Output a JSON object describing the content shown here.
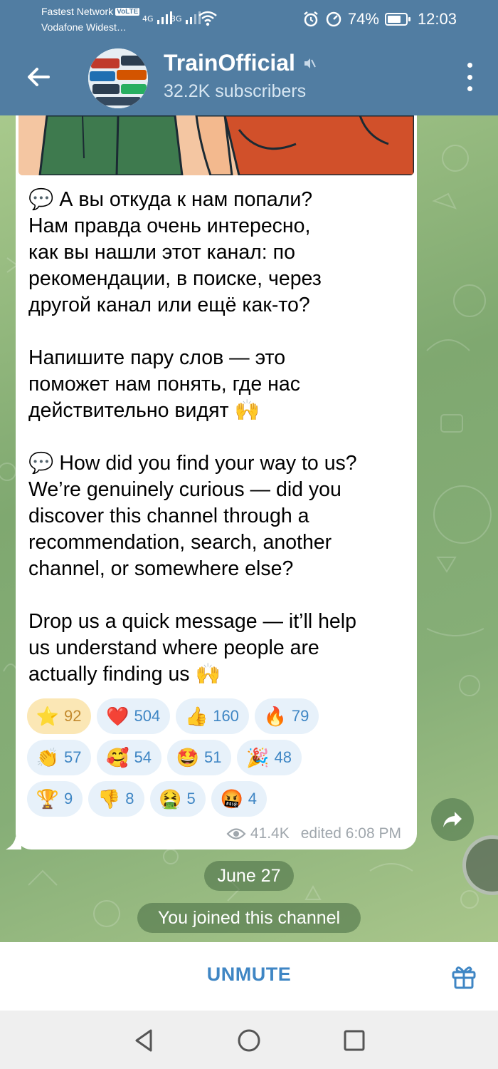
{
  "status_bar": {
    "carrier_line1": "Fastest Network",
    "volte": "VoLTE",
    "carrier_line2": "Vodafone Widest…",
    "net1": "4G",
    "net2": "3G",
    "battery_percent": "74%",
    "battery_level": 0.74,
    "time": "12:03"
  },
  "header": {
    "channel_name": "TrainOfficial",
    "subscribers": "32.2K subscribers",
    "muted": true
  },
  "message": {
    "para1": "А вы откуда к нам попали?\nНам правда очень интересно,\nкак вы нашли этот канал: по\nрекомендации, в поиске, через\nдругой канал или ещё как-то?",
    "para2": "Напишите пару слов — это\nпоможет нам понять, где нас\nдействительно видят",
    "para3": "How did you find your way to us?\nWe’re genuinely curious — did you\ndiscover this channel through a\nrecommendation, search, another\nchannel, or somewhere else?",
    "para4": "Drop us a quick message — it’ll help\nus understand where people are\nactually finding us",
    "views": "41.4K",
    "edited": "edited 6:08 PM"
  },
  "reactions": [
    [
      {
        "emoji": "⭐",
        "count": "92",
        "active": true
      },
      {
        "emoji": "❤️",
        "count": "504"
      },
      {
        "emoji": "👍",
        "count": "160"
      },
      {
        "emoji": "🔥",
        "count": "79"
      }
    ],
    [
      {
        "emoji": "👏",
        "count": "57"
      },
      {
        "emoji": "🥰",
        "count": "54"
      },
      {
        "emoji": "🤩",
        "count": "51"
      },
      {
        "emoji": "🎉",
        "count": "48"
      }
    ],
    [
      {
        "emoji": "🏆",
        "count": "9"
      },
      {
        "emoji": "👎",
        "count": "8"
      },
      {
        "emoji": "🤮",
        "count": "5"
      },
      {
        "emoji": "🤬",
        "count": "4"
      }
    ]
  ],
  "service": {
    "date": "June 27",
    "joined": "You joined this channel"
  },
  "bottom": {
    "unmute_label": "UNMUTE"
  },
  "colors": {
    "header": "#517da2",
    "accent": "#3f86c4",
    "active_reaction_bg": "#fbe7b5"
  }
}
